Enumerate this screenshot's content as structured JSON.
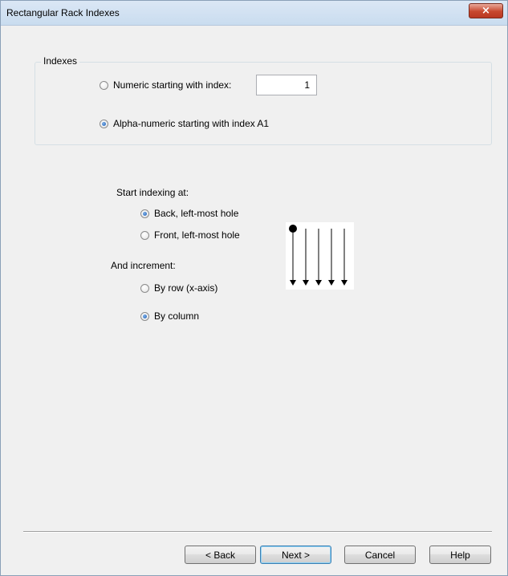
{
  "window": {
    "title": "Rectangular Rack Indexes",
    "close_glyph": "×"
  },
  "indexes": {
    "group_title": "Indexes",
    "numeric_label": "Numeric starting with index:",
    "numeric_value": "1",
    "numeric_selected": false,
    "alpha_label": "Alpha-numeric starting with index A1",
    "alpha_selected": true
  },
  "start": {
    "heading": "Start indexing at:",
    "back_label": "Back, left-most hole",
    "back_selected": true,
    "front_label": "Front, left-most hole",
    "front_selected": false
  },
  "increment": {
    "heading": "And increment:",
    "row_label": "By row (x-axis)",
    "row_selected": false,
    "column_label": "By column",
    "column_selected": true
  },
  "diagram": {
    "icon": "column-indexing-arrows-icon",
    "columns": 5
  },
  "buttons": {
    "back": "< Back",
    "next": "Next >",
    "cancel": "Cancel",
    "help": "Help"
  }
}
